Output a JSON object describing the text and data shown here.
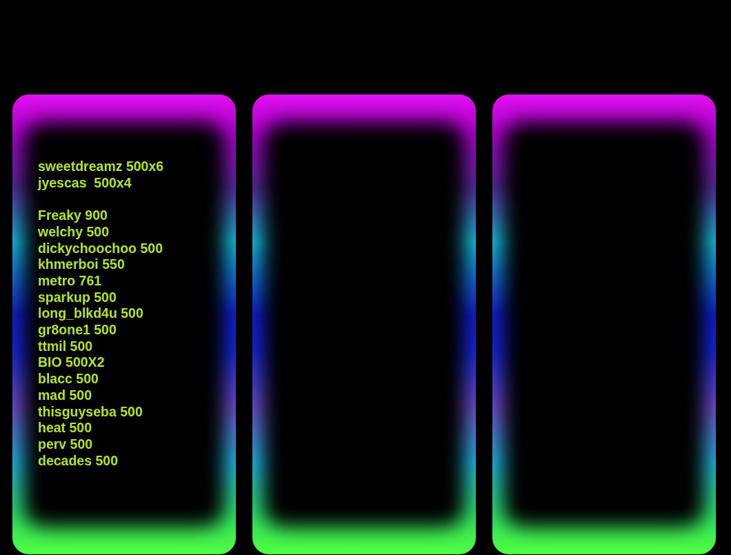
{
  "panels": [
    {
      "kind": "list",
      "groups": [
        [
          "sweetdreamz 500x6",
          "jyescas  500x4"
        ],
        [
          "Freaky 900",
          "welchy 500",
          "dickychoochoo 500",
          "khmerboi 550",
          "metro 761",
          "sparkup 500",
          "long_blkd4u 500",
          "gr8one1 500",
          "ttmil 500",
          "BIO 500X2",
          "blacc 500",
          "mad 500",
          "thisguyseba 500",
          "heat 500",
          "perv 500",
          "decades 500"
        ]
      ]
    },
    {
      "kind": "empty"
    },
    {
      "kind": "empty"
    }
  ]
}
